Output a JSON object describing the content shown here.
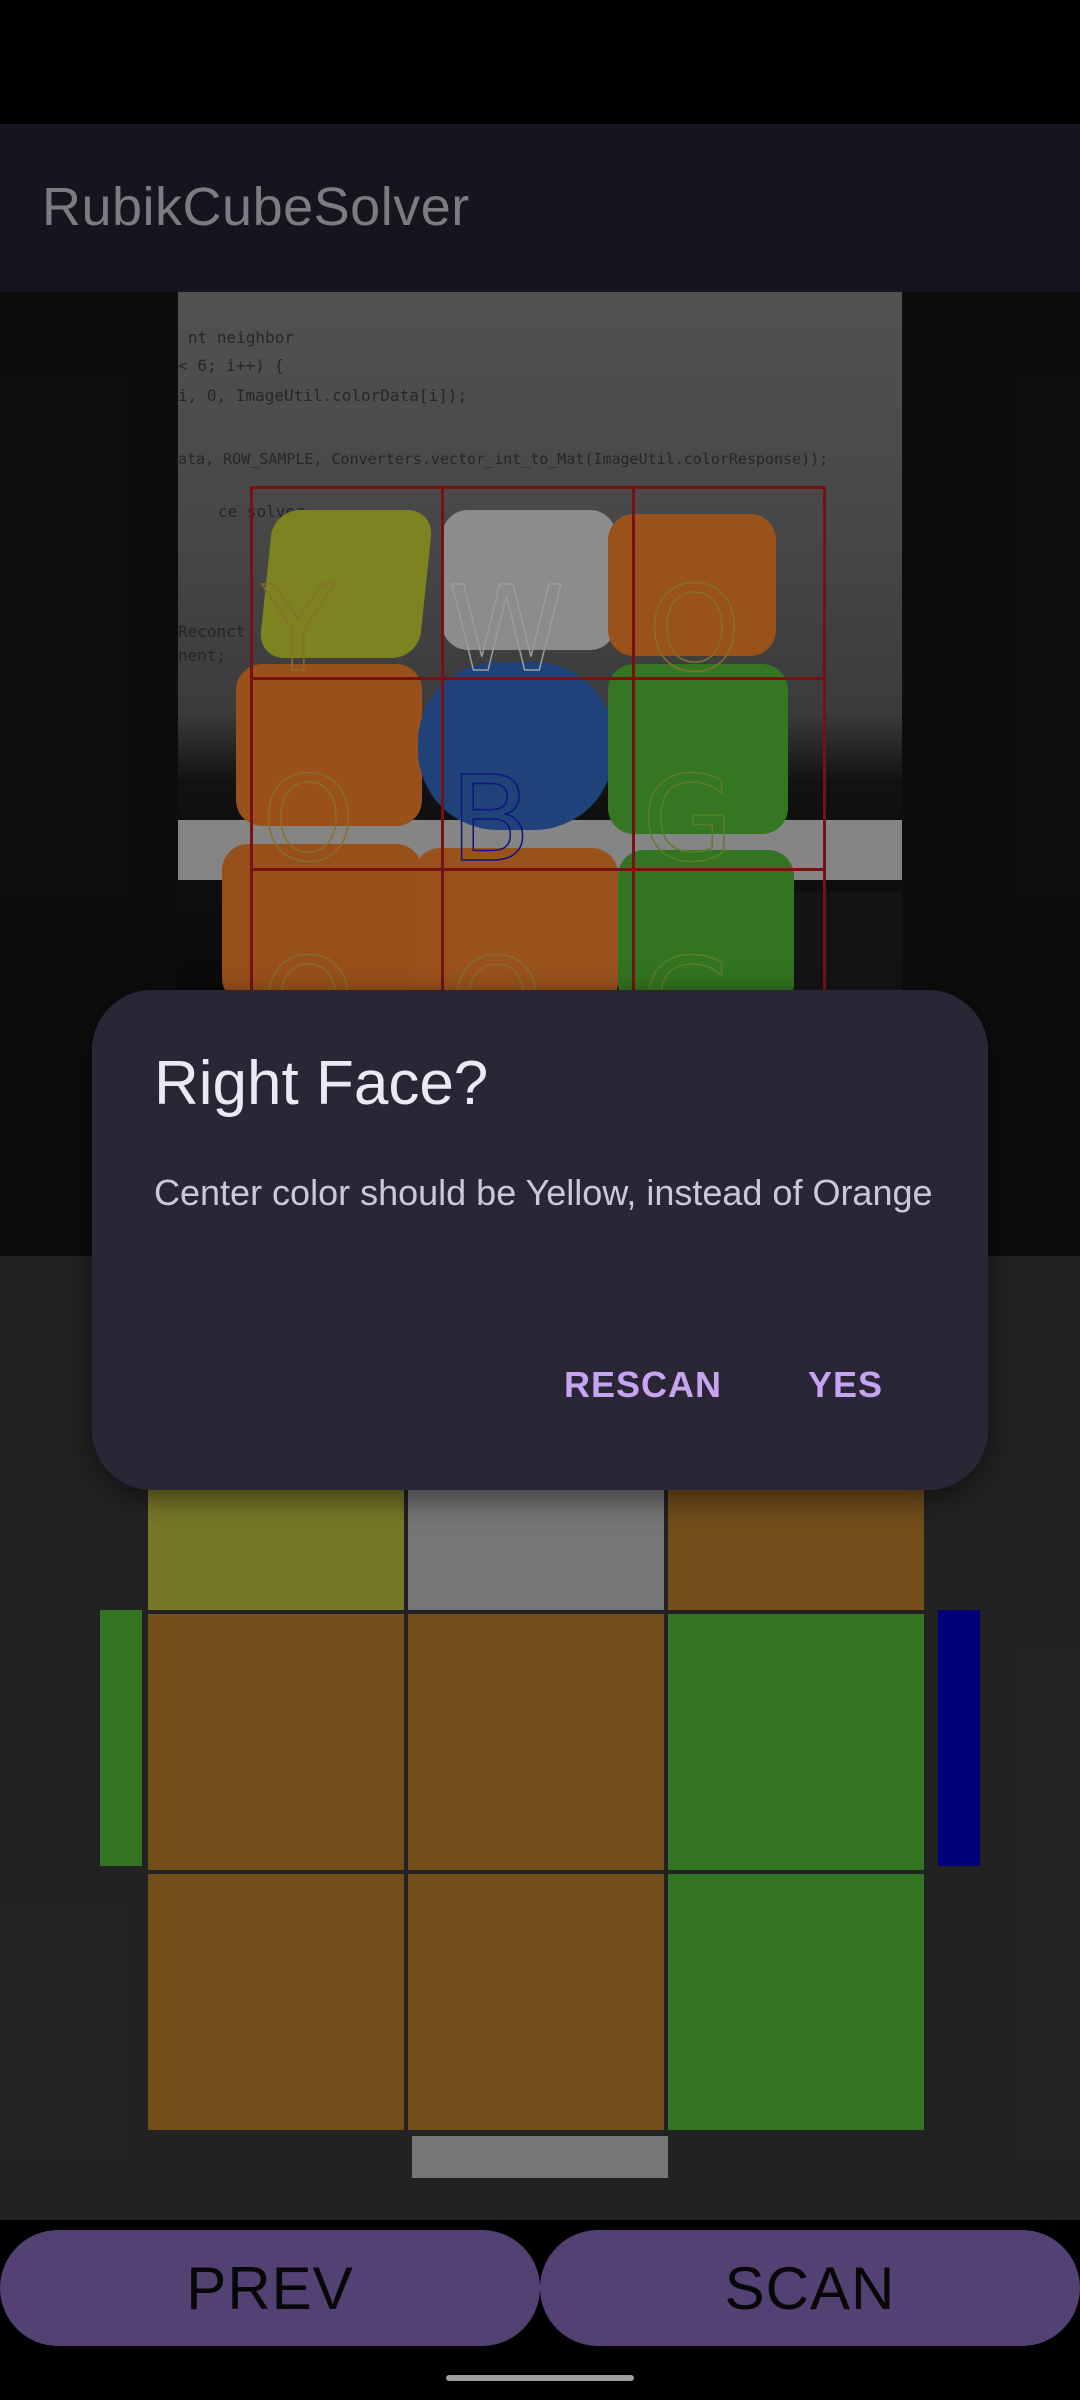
{
  "app": {
    "title": "RubikCubeSolver"
  },
  "camera": {
    "code_lines": [
      "nt neighbor",
      "< 6; i++) {",
      "i, 0, ImageUtil.colorData[i]);",
      "ata, ROW_SAMPLE, Converters.vector_int_to_Mat(ImageUtil.colorResponse));",
      "ce solver",
      "Reconct",
      "nent;"
    ],
    "grid_letters": [
      "Y",
      "W",
      "O",
      "O",
      "B",
      "G",
      "O",
      "O",
      "G"
    ]
  },
  "face_preview": {
    "colors": {
      "yellow": "#b0b03c",
      "white": "#aeaeae",
      "orange": "#a87428",
      "green": "#4fab33",
      "blue": "#0000b3",
      "border": "#333333"
    },
    "cells": [
      "yellow",
      "white",
      "orange",
      "orange",
      "orange",
      "green",
      "orange",
      "orange",
      "green"
    ],
    "left_neighbor": "green",
    "right_neighbor": "blue",
    "bottom_neighbor": "white"
  },
  "buttons": {
    "prev": "PREV",
    "scan": "SCAN"
  },
  "dialog": {
    "title": "Right Face?",
    "message": "Center color should be Yellow, instead of Orange",
    "rescan": "RESCAN",
    "yes": "YES"
  },
  "accent": "#7b60aa"
}
